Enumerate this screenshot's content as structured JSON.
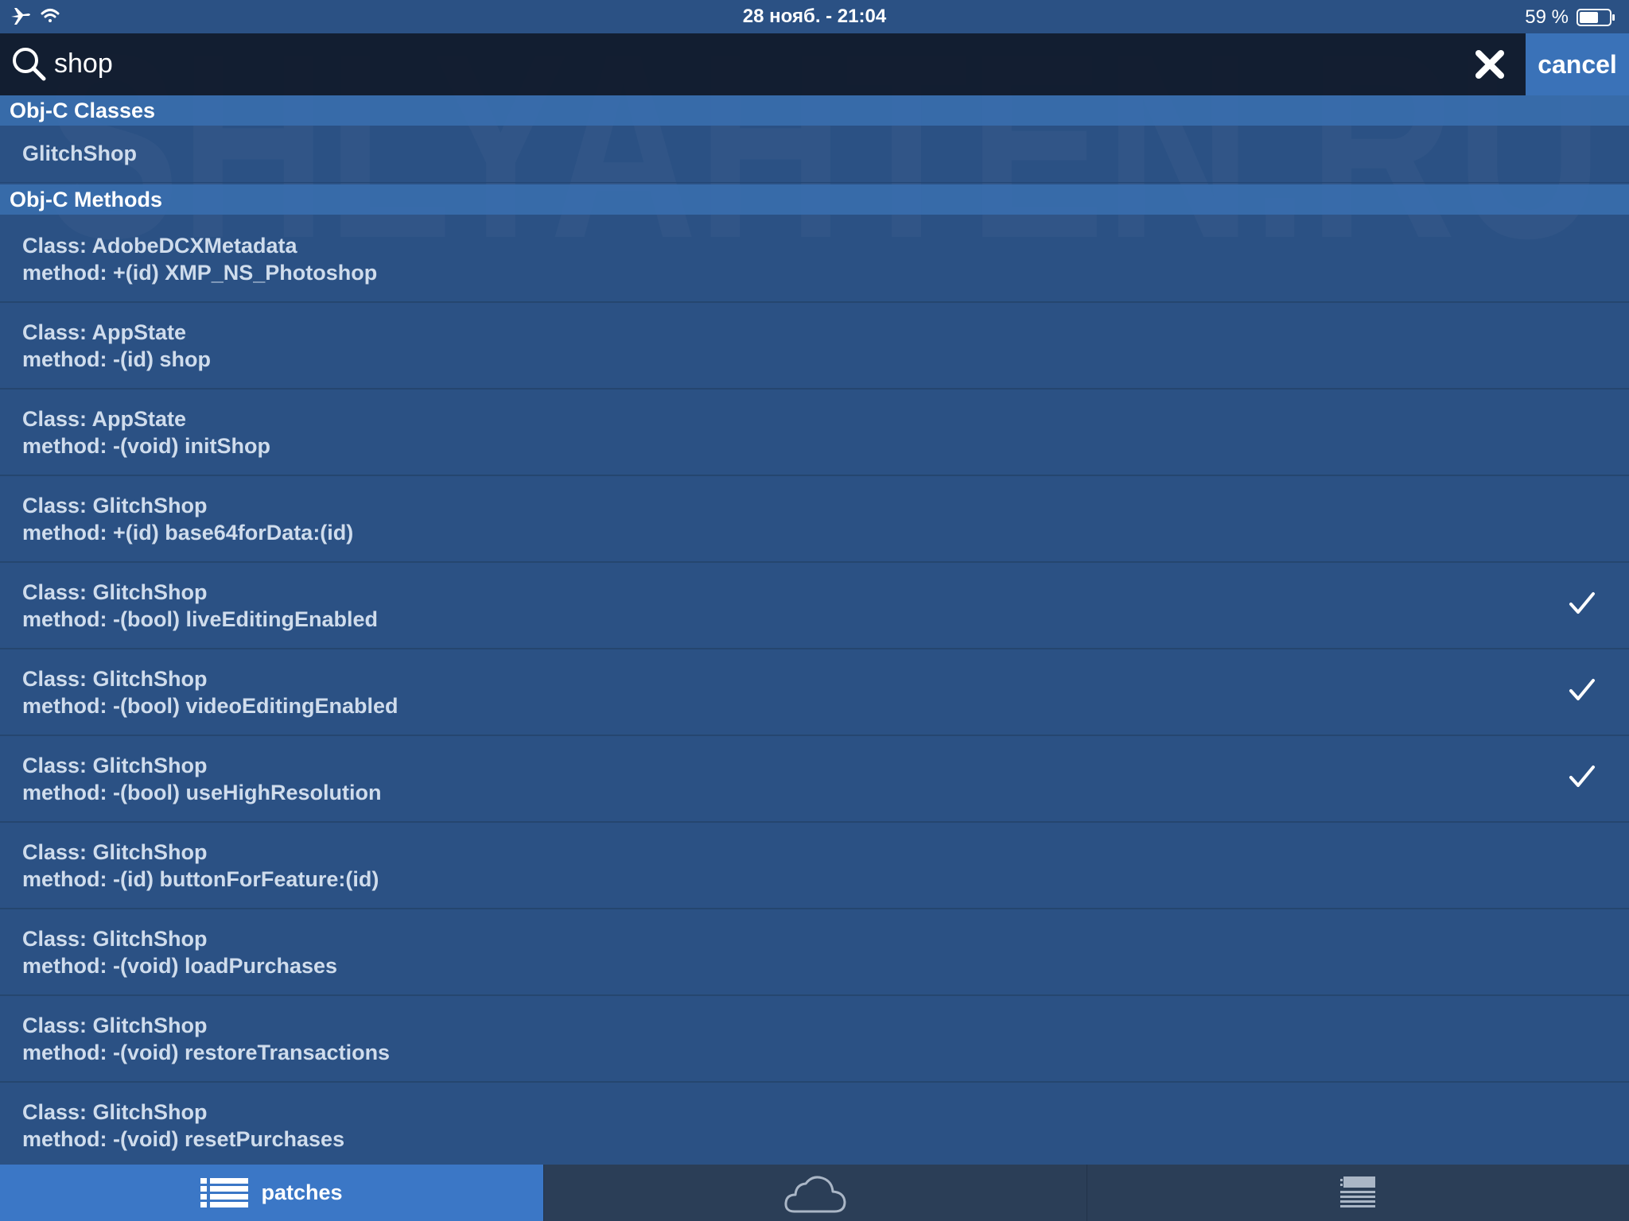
{
  "status_bar": {
    "time": "28 нояб. - 21:04",
    "battery": "59 %"
  },
  "search": {
    "value": "shop",
    "placeholder": "",
    "cancel_label": "cancel"
  },
  "watermark": {
    "text": "SHLYAHTEN.RU"
  },
  "classes_section": {
    "title": "Obj-C Classes",
    "items": [
      "GlitchShop"
    ]
  },
  "methods_section": {
    "title": "Obj-C Methods",
    "items": [
      {
        "class": "Class: AdobeDCXMetadata",
        "method": "method: +(id) XMP_NS_Photoshop",
        "checked": false
      },
      {
        "class": "Class: AppState",
        "method": "method: -(id) shop",
        "checked": false
      },
      {
        "class": "Class: AppState",
        "method": "method: -(void) initShop",
        "checked": false
      },
      {
        "class": "Class: GlitchShop",
        "method": "method: +(id) base64forData:(id)",
        "checked": false
      },
      {
        "class": "Class: GlitchShop",
        "method": "method: -(bool) liveEditingEnabled",
        "checked": true
      },
      {
        "class": "Class: GlitchShop",
        "method": "method: -(bool) videoEditingEnabled",
        "checked": true
      },
      {
        "class": "Class: GlitchShop",
        "method": "method: -(bool) useHighResolution",
        "checked": true
      },
      {
        "class": "Class: GlitchShop",
        "method": "method: -(id) buttonForFeature:(id)",
        "checked": false
      },
      {
        "class": "Class: GlitchShop",
        "method": "method: -(void) loadPurchases",
        "checked": false
      },
      {
        "class": "Class: GlitchShop",
        "method": "method: -(void) restoreTransactions",
        "checked": false
      },
      {
        "class": "Class: GlitchShop",
        "method": "method: -(void) resetPurchases",
        "checked": false
      }
    ]
  },
  "tab_bar": {
    "tabs": [
      {
        "label": "patches",
        "icon": "list-icon",
        "active": true
      },
      {
        "label": "",
        "icon": "cloud-icon",
        "active": false
      },
      {
        "label": "",
        "icon": "log-icon",
        "active": false
      }
    ]
  },
  "colors": {
    "background": "#2b5184",
    "section_header": "#3b72b4",
    "search_bar": "#111b2c",
    "cancel_button": "#3a72b8",
    "active_tab": "#3b77c6",
    "tab_bar": "#2b3e57",
    "text": "#cfdcec"
  }
}
